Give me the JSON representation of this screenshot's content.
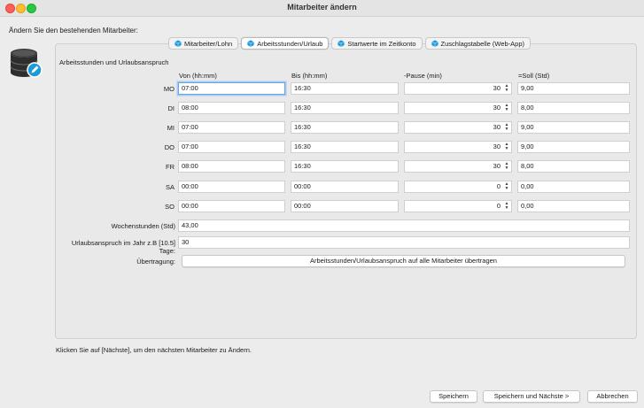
{
  "window": {
    "title": "Mitarbeiter ändern"
  },
  "intro": "Ändern Sie den bestehenden Mitarbeiter:",
  "tabs": [
    {
      "label": "Mitarbeiter/Lohn",
      "icon": "cube-icon",
      "active": false
    },
    {
      "label": "Arbeitsstunden/Urlaub",
      "icon": "cube-icon",
      "active": true
    },
    {
      "label": "Startwerte im Zeitkonto",
      "icon": "cube-icon",
      "active": false
    },
    {
      "label": "Zuschlagstabelle (Web-App)",
      "icon": "cube-icon",
      "active": false
    }
  ],
  "section_title": "Arbeitsstunden und Urlaubsanspruch",
  "columns": {
    "von": "Von (hh:mm)",
    "bis": "Bis (hh:mm)",
    "pause": "-Pause (min)",
    "soll": "=Soll (Std)"
  },
  "days": [
    {
      "label": "MO",
      "von": "07:00",
      "bis": "16:30",
      "pause": "30",
      "soll": "9,00"
    },
    {
      "label": "DI",
      "von": "08:00",
      "bis": "16:30",
      "pause": "30",
      "soll": "8,00"
    },
    {
      "label": "MI",
      "von": "07:00",
      "bis": "16:30",
      "pause": "30",
      "soll": "9,00"
    },
    {
      "label": "DO",
      "von": "07:00",
      "bis": "16:30",
      "pause": "30",
      "soll": "9,00"
    },
    {
      "label": "FR",
      "von": "08:00",
      "bis": "16:30",
      "pause": "30",
      "soll": "8,00"
    },
    {
      "label": "SA",
      "von": "00:00",
      "bis": "00:00",
      "pause": "0",
      "soll": "0,00"
    },
    {
      "label": "SO",
      "von": "00:00",
      "bis": "00:00",
      "pause": "0",
      "soll": "0,00"
    }
  ],
  "wochenstunden": {
    "label": "Wochenstunden (Std)",
    "value": "43,00"
  },
  "urlaub": {
    "label": "Urlaubsanspruch im Jahr z.B [10.5] Tage:",
    "value": "30"
  },
  "uebertragung": {
    "label": "Übertragung:",
    "button": "Arbeitsstunden/Urlaubsanspruch auf alle Mitarbeiter übertragen"
  },
  "hint": "Klicken Sie auf [Nächste], um den nächsten Mitarbeiter zu Ändern.",
  "buttons": {
    "save": "Speichern",
    "save_next": "Speichern und Nächste >",
    "cancel": "Abbrechen"
  },
  "colors": {
    "accent": "#1e9bd7",
    "focus": "#6aa2e8",
    "close": "#ff5f57",
    "minimize": "#febc2e",
    "maximize": "#28c840"
  }
}
